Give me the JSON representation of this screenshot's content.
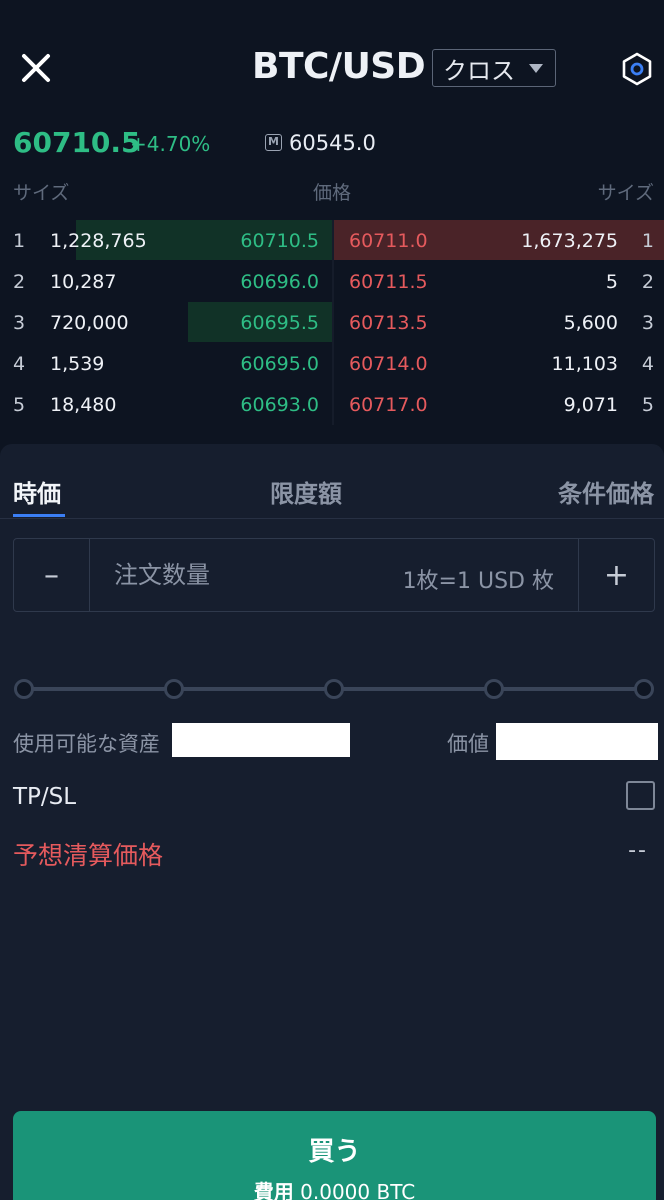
{
  "header": {
    "pair": "BTC/USD",
    "margin_mode": "クロス"
  },
  "ticker": {
    "last_price": "60710.5",
    "change_pct": "+4.70%",
    "mark_badge": "M",
    "mark_price": "60545.0"
  },
  "orderbook": {
    "header": {
      "size_left": "サイズ",
      "price": "価格",
      "size_right": "サイズ"
    },
    "rows": [
      {
        "idx": "1",
        "bid_size": "1,228,765",
        "bid_price": "60710.5",
        "ask_price": "60711.0",
        "ask_size": "1,673,275"
      },
      {
        "idx": "2",
        "bid_size": "10,287",
        "bid_price": "60696.0",
        "ask_price": "60711.5",
        "ask_size": "5"
      },
      {
        "idx": "3",
        "bid_size": "720,000",
        "bid_price": "60695.5",
        "ask_price": "60713.5",
        "ask_size": "5,600"
      },
      {
        "idx": "4",
        "bid_size": "1,539",
        "bid_price": "60695.0",
        "ask_price": "60714.0",
        "ask_size": "11,103"
      },
      {
        "idx": "5",
        "bid_size": "18,480",
        "bid_price": "60693.0",
        "ask_price": "60717.0",
        "ask_size": "9,071"
      }
    ],
    "bid_depth_fraction": [
      0.8,
      0.0,
      0.45,
      0.0,
      0.0
    ],
    "ask_depth_fraction": [
      1.0,
      0.0,
      0.0,
      0.0,
      0.0
    ]
  },
  "order_form": {
    "tabs": {
      "market": "時価",
      "limit": "限度額",
      "conditional": "条件価格"
    },
    "quantity_placeholder": "注文数量",
    "quantity_value": "",
    "quantity_unit": "1枚=1 USD 枚",
    "minus": "–",
    "plus": "+",
    "slider_level": 0,
    "available_label": "使用可能な資産",
    "value_label": "価値",
    "tpsl_label": "TP/SL",
    "tpsl_checked": false,
    "liq_label": "予想清算価格",
    "liq_value": "--",
    "buy_label": "買う",
    "buy_cost_prefix": "費用",
    "buy_cost_value": "0.0000 BTC"
  },
  "colors": {
    "background": "#0d1421",
    "bid": "#2ebd85",
    "ask": "#e55a5d",
    "accent": "#3b7ff5",
    "buy_button": "#1a9478"
  },
  "icons": {
    "close": "close-icon",
    "settings": "hexagon-settings-icon",
    "caret": "caret-down-icon"
  }
}
